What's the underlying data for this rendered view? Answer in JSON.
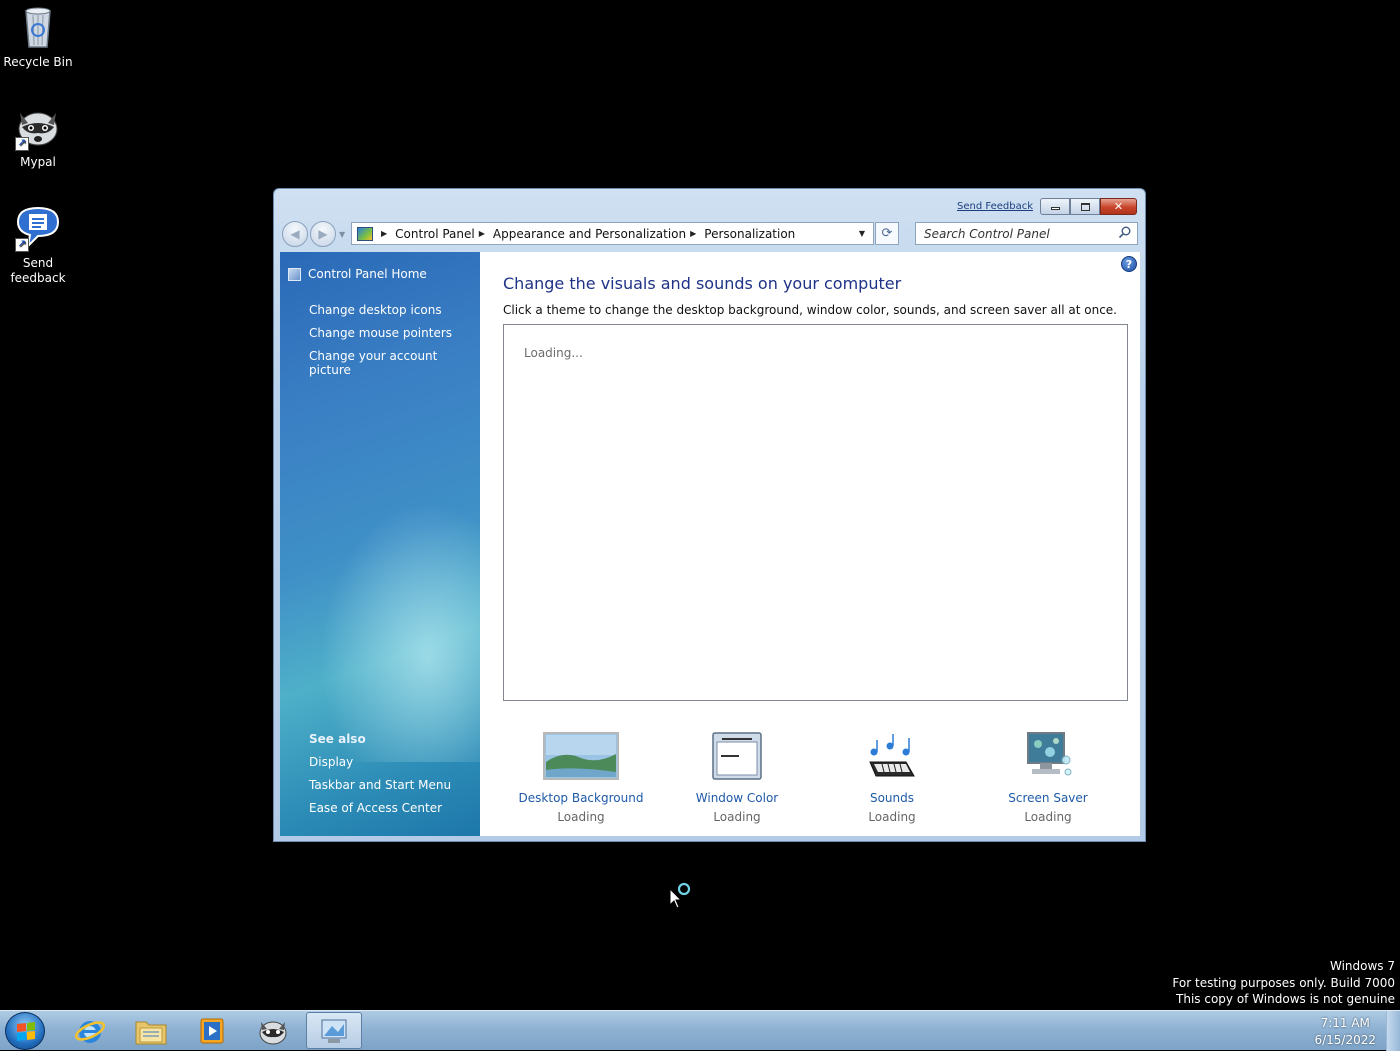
{
  "desktop": {
    "icons": [
      {
        "label": "Recycle Bin",
        "icon": "recycle-bin-icon"
      },
      {
        "label": "Mypal",
        "icon": "mypal-raccoon-icon"
      },
      {
        "label": "Send feedback",
        "icon": "send-feedback-icon"
      }
    ],
    "watermark": {
      "line1": "Windows 7",
      "line2": "For testing purposes only. Build 7000",
      "line3": "This copy of Windows is not genuine"
    }
  },
  "window": {
    "send_feedback": "Send Feedback",
    "close_glyph": "✕",
    "address": {
      "crumbs": [
        "Control Panel",
        "Appearance and Personalization",
        "Personalization"
      ]
    },
    "search": {
      "placeholder": "Search Control Panel"
    },
    "sidebar": {
      "home": "Control Panel Home",
      "links": [
        "Change desktop icons",
        "Change mouse pointers",
        "Change your account picture"
      ],
      "see_also_title": "See also",
      "see_also": [
        "Display",
        "Taskbar and Start Menu",
        "Ease of Access Center"
      ]
    },
    "main": {
      "heading": "Change the visuals and sounds on your computer",
      "subtext": "Click a theme to change the desktop background, window color, sounds, and screen saver all at once.",
      "themes_loading": "Loading...",
      "help_glyph": "?",
      "tiles": [
        {
          "label": "Desktop Background",
          "status": "Loading",
          "icon": "desktop-background-icon"
        },
        {
          "label": "Window Color",
          "status": "Loading",
          "icon": "window-color-icon"
        },
        {
          "label": "Sounds",
          "status": "Loading",
          "icon": "sounds-icon"
        },
        {
          "label": "Screen Saver",
          "status": "Loading",
          "icon": "screen-saver-icon"
        }
      ]
    }
  },
  "taskbar": {
    "pinned": [
      "internet-explorer-icon",
      "windows-explorer-icon",
      "media-player-icon",
      "mypal-icon",
      "control-panel-icon"
    ],
    "clock": {
      "time": "7:11 AM",
      "date": "6/15/2022"
    }
  },
  "colors": {
    "link": "#1e5aa8",
    "heading": "#1e3287",
    "sidebar": "#3a7fc4",
    "taskbar": "#8fb2d3"
  }
}
